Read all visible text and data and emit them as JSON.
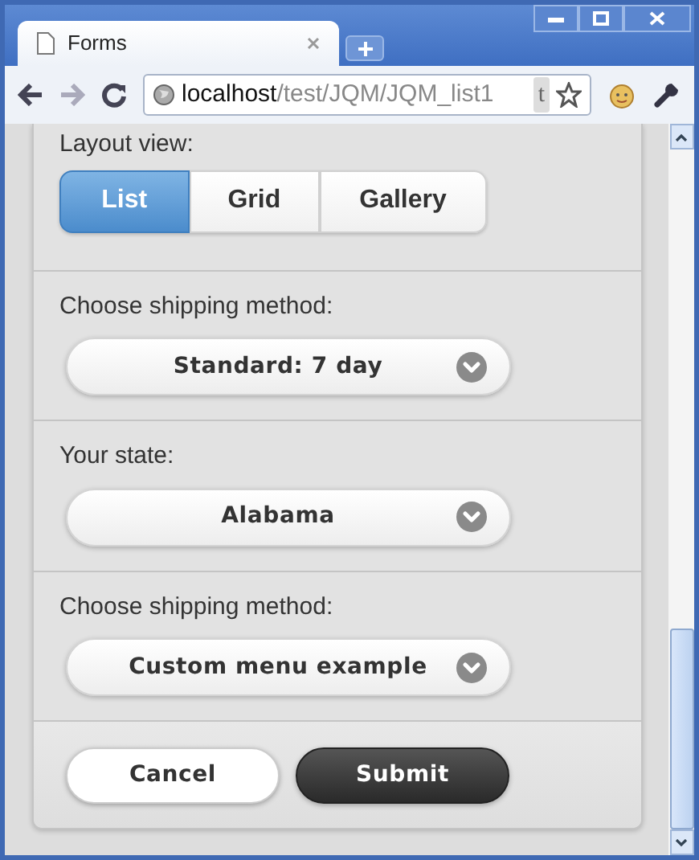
{
  "browser": {
    "tab_title": "Forms",
    "url_host": "localhost",
    "url_path": "/test/JQM/JQM_list1",
    "extension_badge": "t"
  },
  "layout_view": {
    "label": "Layout view:",
    "options": [
      {
        "label": "List",
        "selected": true
      },
      {
        "label": "Grid",
        "selected": false
      },
      {
        "label": "Gallery",
        "selected": false
      }
    ]
  },
  "fields": [
    {
      "label": "Choose shipping method:",
      "value": "Standard: 7 day"
    },
    {
      "label": "Your state:",
      "value": "Alabama"
    },
    {
      "label": "Choose shipping method:",
      "value": "Custom menu example"
    }
  ],
  "buttons": [
    {
      "label": "Cancel",
      "kind": "secondary"
    },
    {
      "label": "Submit",
      "kind": "primary"
    }
  ]
}
